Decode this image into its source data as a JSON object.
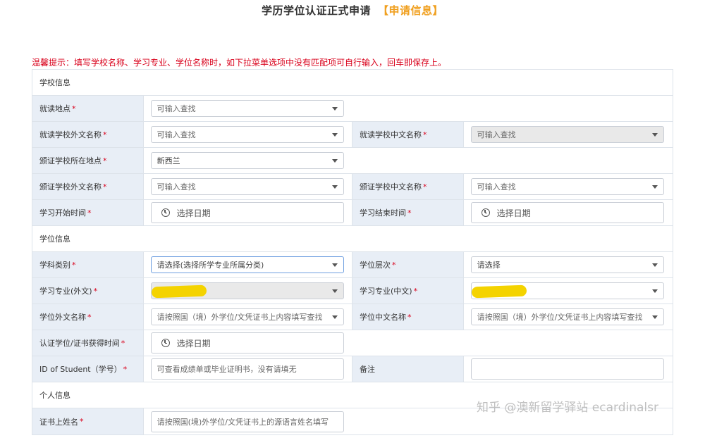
{
  "page": {
    "title": "学历学位认证正式申请",
    "title_tag": "【申请信息】",
    "tip": "温馨提示：填写学校名称、学习专业、学位名称时，如下拉菜单选项中没有匹配项可自行输入，回车即保存上。",
    "watermark": "知乎 @澳新留学驿站 ecardinalsr"
  },
  "colors": {
    "accent_orange": "#f0a020",
    "required_red": "#d9001b",
    "label_bg": "#e8eef6",
    "border": "#dde3ea",
    "redaction_yellow": "#f4d300"
  },
  "sections": {
    "school": "学校信息",
    "degree": "学位信息",
    "personal": "个人信息"
  },
  "fields": {
    "study_location": {
      "label": "就读地点",
      "value": "可输入查找"
    },
    "school_foreign_name": {
      "label": "就读学校外文名称",
      "value": "可输入查找"
    },
    "school_chinese_name": {
      "label": "就读学校中文名称 ",
      "value": "可输入查找"
    },
    "issuing_location": {
      "label": "颁证学校所在地点 ",
      "value": "新西兰"
    },
    "issuing_foreign_name": {
      "label": "颁证学校外文名称 ",
      "value": "可输入查找"
    },
    "issuing_chinese_name": {
      "label": "颁证学校中文名称 ",
      "value": "可输入查找"
    },
    "study_start": {
      "label": "学习开始时间 ",
      "value": "选择日期"
    },
    "study_end": {
      "label": "学习结束时间 ",
      "value": "选择日期"
    },
    "discipline": {
      "label": "学科类别 ",
      "value": "请选择(选择所学专业所属分类)"
    },
    "degree_level": {
      "label": "学位层次 ",
      "value": "请选择"
    },
    "major_foreign": {
      "label": "学习专业(外文)",
      "value": ""
    },
    "major_chinese": {
      "label": "学习专业(中文) ",
      "value": ""
    },
    "degree_foreign_name": {
      "label": "学位外文名称 ",
      "value": "请按照国（境）外学位/文凭证书上内容填写查找"
    },
    "degree_chinese_name": {
      "label": "学位中文名称",
      "value": "请按照国（境）外学位/文凭证书上内容填写查找"
    },
    "degree_obtained_time": {
      "label": "认证学位/证书获得时间",
      "value": "选择日期"
    },
    "student_id": {
      "label": "ID of Student（学号） ",
      "placeholder": "可查看成绩单或毕业证明书，没有请填无"
    },
    "remarks": {
      "label": "备注",
      "placeholder": ""
    },
    "certificate_name": {
      "label": "证书上姓名",
      "placeholder": "请按照国(境)外学位/文凭证书上的源语言姓名填写"
    }
  },
  "required_mark": "*"
}
